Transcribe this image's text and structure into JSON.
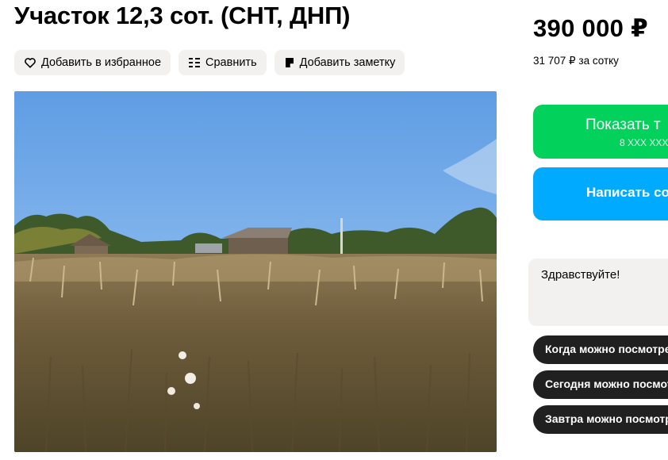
{
  "listing": {
    "title": "Участок 12,3 сот. (СНТ, ДНП)"
  },
  "actions": {
    "favorite_label": "Добавить в избранное",
    "compare_label": "Сравнить",
    "note_label": "Добавить заметку"
  },
  "photo": {
    "subject": "field-with-houses-photo"
  },
  "pricing": {
    "price": "390 000 ₽",
    "price_per_unit": "31 707 ₽ за сотку"
  },
  "contact": {
    "show_phone_label": "Показать т",
    "phone_masked": "8 XXX XXX",
    "write_message_label": "Написать со"
  },
  "message": {
    "draft_text": "Здравствуйте!"
  },
  "quick_replies": [
    "Когда можно посмотре",
    "Сегодня можно посмот",
    "Завтра можно посмотр"
  ],
  "colors": {
    "green_button": "#02d15c",
    "blue_button": "#00aaff",
    "chip_background": "#202020",
    "light_button": "#f2f1f0"
  },
  "icons": [
    "heart-icon",
    "compare-icon",
    "note-icon"
  ]
}
